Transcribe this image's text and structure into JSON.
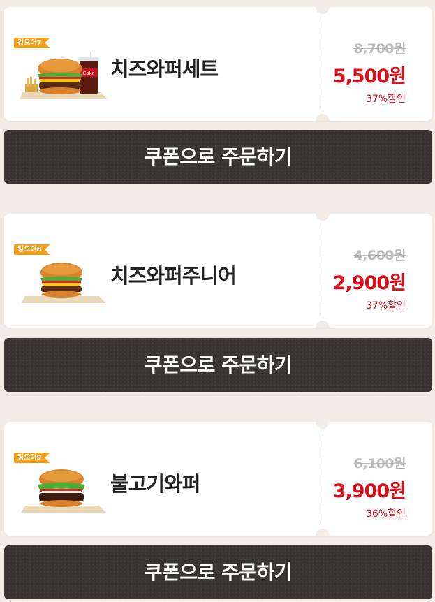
{
  "coupons": [
    {
      "badge": "킹오더7",
      "name": "치즈와퍼세트",
      "original_price": "8,700원",
      "price": "5,500원",
      "discount": "37%할인",
      "image_icon": "burger-set-with-coke-icon",
      "button_label": "쿠폰으로 주문하기"
    },
    {
      "badge": "킹오더8",
      "name": "치즈와퍼주니어",
      "original_price": "4,600원",
      "price": "2,900원",
      "discount": "37%할인",
      "image_icon": "cheeseburger-icon",
      "button_label": "쿠폰으로 주문하기"
    },
    {
      "badge": "킹오더9",
      "name": "불고기와퍼",
      "original_price": "6,100원",
      "price": "3,900원",
      "discount": "36%할인",
      "image_icon": "bulgogi-burger-icon",
      "button_label": "쿠폰으로 주문하기"
    }
  ],
  "colors": {
    "background": "#f2ece7",
    "badge": "#f5a01a",
    "price_red": "#d6111b",
    "button_dark": "#383533"
  }
}
